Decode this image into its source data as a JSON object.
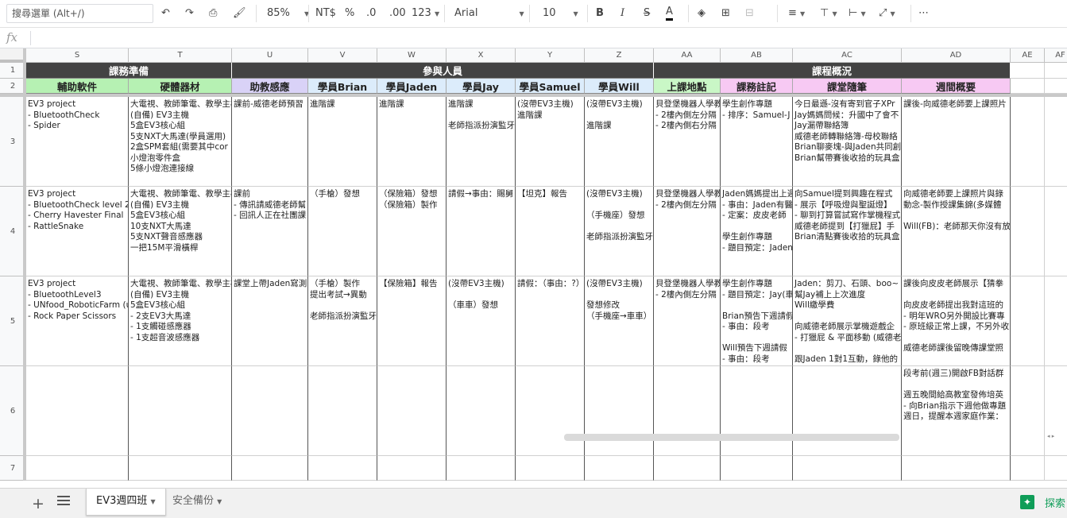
{
  "toolbar": {
    "search_menus": "搜尋選單 (Alt+/)",
    "zoom": "85%",
    "currency": "NT$",
    "percent": "%",
    "decrease_decimal": ".0",
    "increase_decimal": ".00",
    "more_formats": "123",
    "font": "Arial",
    "font_size": "10",
    "bold": "B",
    "italic": "I",
    "strikethrough": "S",
    "text_color": "A",
    "more": "⋯"
  },
  "formula_bar": {
    "fx": "fx",
    "value": ""
  },
  "columns": [
    "S",
    "T",
    "U",
    "V",
    "W",
    "X",
    "Y",
    "Z",
    "AA",
    "AB",
    "AC",
    "AD",
    "AE",
    "AF"
  ],
  "rows": [
    "1",
    "2",
    "3",
    "4",
    "5",
    "6",
    "7"
  ],
  "header_row1": {
    "group1": "課務準備",
    "group2": "參與人員",
    "group3": "課程概況"
  },
  "header_row2": [
    "輔助軟件",
    "硬體器材",
    "助教感應",
    "學員Brian",
    "學員Jaden",
    "學員Jay",
    "學員Samuel",
    "學員Will",
    "上課地點",
    "課務註記",
    "課堂隨筆",
    "週間概要"
  ],
  "header_row2_colors": [
    "#b6f1b3",
    "#b6f1b3",
    "#d9d2f7",
    "#dcecfb",
    "#dcecfb",
    "#dcecfb",
    "#dcecfb",
    "#dcecfb",
    "#c9f7c6",
    "#f7c9f3",
    "#f7c9f3",
    "#f7c9f3"
  ],
  "cells": {
    "r3": [
      "EV3 project\n- BluetoothCheck\n- Spider",
      "大電視、教師筆電、教學主機\n(自備) EV3主機\n5盒EV3核心組\n5支NXT大馬達(學員選用)\n2盒SPM套組(需要其中cor\n小燈泡零件盒\n5條小燈泡連接線",
      "課前-威德老師預習",
      "進階課",
      "進階課",
      "進階課\n\n老師指派扮演監牙",
      "(沒帶EV3主機)\n進階課",
      "(沒帶EV3主機)\n\n進階課",
      "貝登堡機器人學教\n- 2樓內側左分隔\n- 2樓內側右分隔",
      "學生創作專題\n- 排序：Samuel-J",
      "今日最遜-沒有寄到官子XPr\nJay媽媽問候：升國中了會不\nJay漏帶聯絡簿\n威德老師轉聯絡簿-母校聯絡\nBrian聊麥塊-與Jaden共同創\nBrian幫帶賽後收拾的玩具盒",
      "課後-向威德老師要上課照片"
    ],
    "r4": [
      "EV3 project\n- BluetoothCheck level 2\n- Cherry Havester Final\n- RattleSnake",
      "大電視、教師筆電、教學主機\n(自備) EV3主機\n5盒EV3核心組\n10支NXT大馬達\n5支NXT聲音感應器\n一把15M平滑橫桿",
      "課前\n- 傳訊請威德老師幫\n- 回訊人正在社團課",
      "（手槍）發想",
      "（保險箱）發想\n（保險箱）製作",
      "請假→事由：賜舅",
      "【坦克】報告",
      "(沒帶EV3主機)\n\n（手機座）發想\n\n老師指派扮演監牙",
      "貝登堡機器人學教\n- 2樓內側左分隔",
      "Jaden媽媽提出上週\n- 事由：Jaden有醫\n- 定案：皮皮老師\n\n學生創作專題\n- 題目預定：Jaden",
      "向Samuel提到興趣在程式\n- 展示【呼吸燈與聖誕燈】\n- 聊到打算嘗試寫作掌機程式\n威德老師提到【打獵屁】手\nBrian清點賽後收拾的玩具盒",
      "向威德老師要上課照片與錄\n動念-製作授課集錦(多媒體\n\nWill(FB)：老師那天你沒有放"
    ],
    "r5": [
      "EV3 project\n- BluetoothLevel3\n- UNfood_RoboticFarm (u\n- Rock Paper Scissors",
      "大電視、教師筆電、教學主機\n(自備) EV3主機\n5盒EV3核心組\n- 2支EV3大馬達\n- 1支觸碰感應器\n- 1支超音波感應器",
      "課堂上帶Jaden寫測",
      "（手槍）製作\n提出考試→異動\n\n老師指派扮演監牙",
      "【保險箱】報告",
      "(沒帶EV3主機)\n\n（車車）發想",
      "請假：（事由：?）",
      "(沒帶EV3主機)\n\n發想修改\n（手機座→車車）",
      "貝登堡機器人學教\n- 2樓內側左分隔",
      "學生創作專題\n- 題目預定：Jay(車\n\nBrian預告下週請假\n- 事由：段考\n\nWill預告下週請假\n- 事由：段考",
      "Jaden：剪刀、石頭、boo~\n幫Jay補上上次進度\nWill繳學費\n\n向威德老師展示掌機遊戲企\n- 打獵屁 & 平面移動 (威德老\n\n跟Jaden 1對1互動，錄他的",
      "課後向皮皮老師展示【猜拳\n\n向皮皮老師提出我對這班的\n- 明年WRO另外開設比賽專\n- 原班級正常上課，不另外收\n\n威德老師課後留晚傳課堂照"
    ],
    "r6": [
      "",
      "",
      "",
      "",
      "",
      "",
      "",
      "",
      "",
      "",
      "",
      "段考前(週三)開啟FB對話群\n\n週五晚間給高教室發佈培英\n- 向Brian指示下週他做專題\n週日，提醒本週家庭作業："
    ],
    "r7": [
      "",
      "",
      "",
      "",
      "",
      "",
      "",
      "",
      "",
      "",
      "",
      ""
    ]
  },
  "sheet_tabs": [
    {
      "label": "EV3週四班",
      "active": true
    },
    {
      "label": "安全備份",
      "active": false
    }
  ],
  "explore_label": "探索",
  "colors": {
    "band_dark": "#434343",
    "accent_green": "#0f9d58"
  }
}
